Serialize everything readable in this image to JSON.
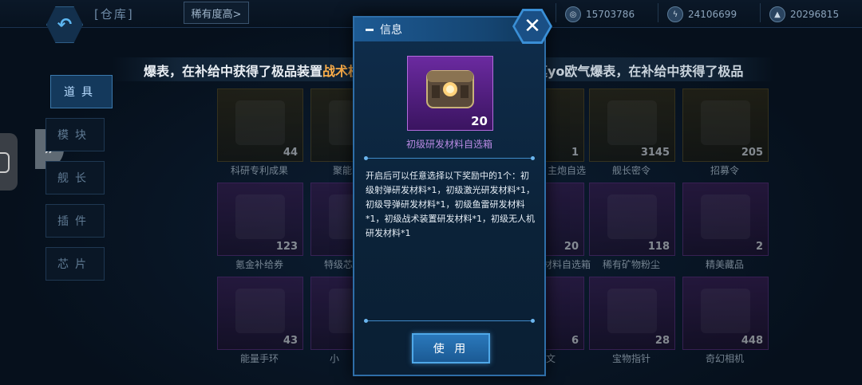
{
  "topbar": {
    "tab_title": "[仓库]",
    "sort_label": "稀有度高>",
    "resources": [
      {
        "icon": "coin-icon",
        "value": "15703786"
      },
      {
        "icon": "energy-icon",
        "value": "24106699"
      },
      {
        "icon": "ship-icon",
        "value": "20296815"
      }
    ]
  },
  "sidebar": {
    "tabs": [
      {
        "label": "道具",
        "active": true
      },
      {
        "label": "模块",
        "active": false
      },
      {
        "label": "舰长",
        "active": false
      },
      {
        "label": "插件",
        "active": false
      },
      {
        "label": "芯片",
        "active": false
      }
    ]
  },
  "marquee": {
    "part1_prefix": "爆表，在补给中获得了极品装置",
    "part1_highlight": "战术核弹",
    "part1_suffix": "！",
    "part2": "尖莫yo欧气爆表，在补给中获得了极品"
  },
  "grid": [
    {
      "name": "科研专利成果",
      "count": "44",
      "tier": "gold"
    },
    {
      "name": "聚能",
      "count": "",
      "tier": "gold"
    },
    {
      "name": "主炮自选",
      "count": "1",
      "tier": "gold"
    },
    {
      "name": "舰长密令",
      "count": "3145",
      "tier": "gold"
    },
    {
      "name": "招募令",
      "count": "205",
      "tier": "gold"
    },
    {
      "name": "氪金补给券",
      "count": "123",
      "tier": "purple"
    },
    {
      "name": "特级芯",
      "count": "",
      "tier": "purple"
    },
    {
      "name": "材料自选箱",
      "count": "20",
      "tier": "purple"
    },
    {
      "name": "稀有矿物粉尘",
      "count": "118",
      "tier": "purple"
    },
    {
      "name": "精美藏品",
      "count": "2",
      "tier": "purple"
    },
    {
      "name": "能量手环",
      "count": "43",
      "tier": "purple"
    },
    {
      "name": "小",
      "count": "",
      "tier": "purple"
    },
    {
      "name": "文",
      "count": "6",
      "tier": "purple"
    },
    {
      "name": "宝物指针",
      "count": "28",
      "tier": "purple"
    },
    {
      "name": "奇幻相机",
      "count": "448",
      "tier": "purple"
    }
  ],
  "modal": {
    "title": "信息",
    "item_name": "初级研发材料自选箱",
    "item_count": "20",
    "description": "开启后可以任意选择以下奖励中的1个：初级射弹研发材料*1，初级激光研发材料*1，初级导弹研发材料*1，初级鱼雷研发材料*1，初级战术装置研发材料*1，初级无人机研发材料*1",
    "use_label": "使 用"
  },
  "colors": {
    "accent": "#2e6ea8",
    "purple_tier": "#b46bdd",
    "gold_tier": "#5a4a1a",
    "highlight": "#ffb04a"
  }
}
